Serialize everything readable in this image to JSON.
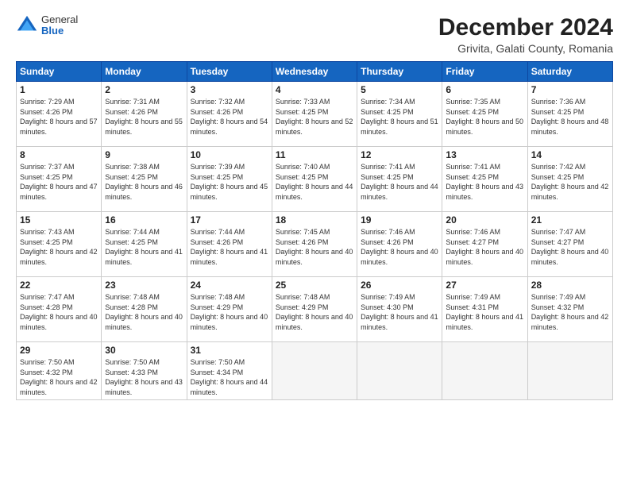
{
  "logo": {
    "general": "General",
    "blue": "Blue"
  },
  "title": "December 2024",
  "subtitle": "Grivita, Galati County, Romania",
  "weekdays": [
    "Sunday",
    "Monday",
    "Tuesday",
    "Wednesday",
    "Thursday",
    "Friday",
    "Saturday"
  ],
  "weeks": [
    [
      {
        "day": "1",
        "sunrise": "7:29 AM",
        "sunset": "4:26 PM",
        "daylight": "8 hours and 57 minutes."
      },
      {
        "day": "2",
        "sunrise": "7:31 AM",
        "sunset": "4:26 PM",
        "daylight": "8 hours and 55 minutes."
      },
      {
        "day": "3",
        "sunrise": "7:32 AM",
        "sunset": "4:26 PM",
        "daylight": "8 hours and 54 minutes."
      },
      {
        "day": "4",
        "sunrise": "7:33 AM",
        "sunset": "4:25 PM",
        "daylight": "8 hours and 52 minutes."
      },
      {
        "day": "5",
        "sunrise": "7:34 AM",
        "sunset": "4:25 PM",
        "daylight": "8 hours and 51 minutes."
      },
      {
        "day": "6",
        "sunrise": "7:35 AM",
        "sunset": "4:25 PM",
        "daylight": "8 hours and 50 minutes."
      },
      {
        "day": "7",
        "sunrise": "7:36 AM",
        "sunset": "4:25 PM",
        "daylight": "8 hours and 48 minutes."
      }
    ],
    [
      {
        "day": "8",
        "sunrise": "7:37 AM",
        "sunset": "4:25 PM",
        "daylight": "8 hours and 47 minutes."
      },
      {
        "day": "9",
        "sunrise": "7:38 AM",
        "sunset": "4:25 PM",
        "daylight": "8 hours and 46 minutes."
      },
      {
        "day": "10",
        "sunrise": "7:39 AM",
        "sunset": "4:25 PM",
        "daylight": "8 hours and 45 minutes."
      },
      {
        "day": "11",
        "sunrise": "7:40 AM",
        "sunset": "4:25 PM",
        "daylight": "8 hours and 44 minutes."
      },
      {
        "day": "12",
        "sunrise": "7:41 AM",
        "sunset": "4:25 PM",
        "daylight": "8 hours and 44 minutes."
      },
      {
        "day": "13",
        "sunrise": "7:41 AM",
        "sunset": "4:25 PM",
        "daylight": "8 hours and 43 minutes."
      },
      {
        "day": "14",
        "sunrise": "7:42 AM",
        "sunset": "4:25 PM",
        "daylight": "8 hours and 42 minutes."
      }
    ],
    [
      {
        "day": "15",
        "sunrise": "7:43 AM",
        "sunset": "4:25 PM",
        "daylight": "8 hours and 42 minutes."
      },
      {
        "day": "16",
        "sunrise": "7:44 AM",
        "sunset": "4:25 PM",
        "daylight": "8 hours and 41 minutes."
      },
      {
        "day": "17",
        "sunrise": "7:44 AM",
        "sunset": "4:26 PM",
        "daylight": "8 hours and 41 minutes."
      },
      {
        "day": "18",
        "sunrise": "7:45 AM",
        "sunset": "4:26 PM",
        "daylight": "8 hours and 40 minutes."
      },
      {
        "day": "19",
        "sunrise": "7:46 AM",
        "sunset": "4:26 PM",
        "daylight": "8 hours and 40 minutes."
      },
      {
        "day": "20",
        "sunrise": "7:46 AM",
        "sunset": "4:27 PM",
        "daylight": "8 hours and 40 minutes."
      },
      {
        "day": "21",
        "sunrise": "7:47 AM",
        "sunset": "4:27 PM",
        "daylight": "8 hours and 40 minutes."
      }
    ],
    [
      {
        "day": "22",
        "sunrise": "7:47 AM",
        "sunset": "4:28 PM",
        "daylight": "8 hours and 40 minutes."
      },
      {
        "day": "23",
        "sunrise": "7:48 AM",
        "sunset": "4:28 PM",
        "daylight": "8 hours and 40 minutes."
      },
      {
        "day": "24",
        "sunrise": "7:48 AM",
        "sunset": "4:29 PM",
        "daylight": "8 hours and 40 minutes."
      },
      {
        "day": "25",
        "sunrise": "7:48 AM",
        "sunset": "4:29 PM",
        "daylight": "8 hours and 40 minutes."
      },
      {
        "day": "26",
        "sunrise": "7:49 AM",
        "sunset": "4:30 PM",
        "daylight": "8 hours and 41 minutes."
      },
      {
        "day": "27",
        "sunrise": "7:49 AM",
        "sunset": "4:31 PM",
        "daylight": "8 hours and 41 minutes."
      },
      {
        "day": "28",
        "sunrise": "7:49 AM",
        "sunset": "4:32 PM",
        "daylight": "8 hours and 42 minutes."
      }
    ],
    [
      {
        "day": "29",
        "sunrise": "7:50 AM",
        "sunset": "4:32 PM",
        "daylight": "8 hours and 42 minutes."
      },
      {
        "day": "30",
        "sunrise": "7:50 AM",
        "sunset": "4:33 PM",
        "daylight": "8 hours and 43 minutes."
      },
      {
        "day": "31",
        "sunrise": "7:50 AM",
        "sunset": "4:34 PM",
        "daylight": "8 hours and 44 minutes."
      },
      null,
      null,
      null,
      null
    ]
  ]
}
